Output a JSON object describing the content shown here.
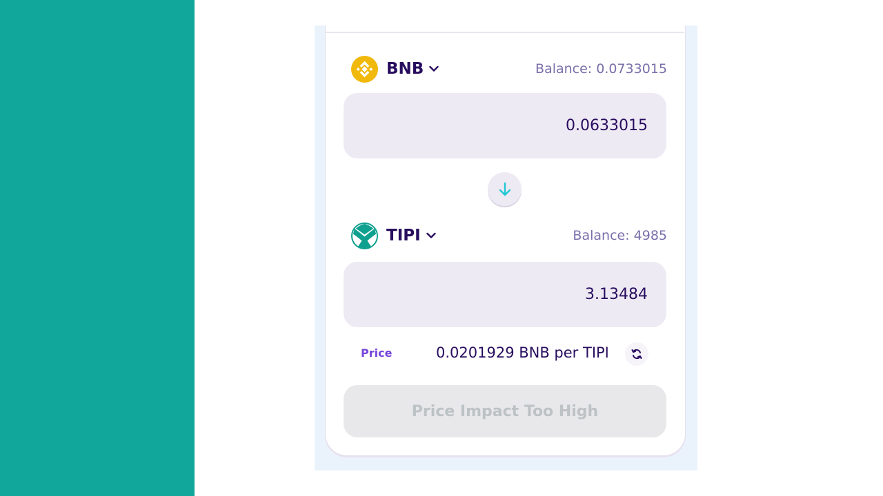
{
  "colors": {
    "sidebar": "#11a79b",
    "text_primary": "#280d5f",
    "text_secondary": "#7a6eaa",
    "accent_purple": "#7645d9",
    "accent_cyan": "#1fc7d4",
    "bnb_yellow": "#f0b90b",
    "tipi_teal": "#0fa08f"
  },
  "from": {
    "token_symbol": "BNB",
    "token_icon": "bnb-logo-icon",
    "balance": "Balance: 0.0733015",
    "amount": "0.0633015"
  },
  "switch": {
    "icon": "arrow-down-icon"
  },
  "to": {
    "token_symbol": "TIPI",
    "token_icon": "tipi-logo-icon",
    "balance": "Balance: 4985",
    "amount": "3.13484"
  },
  "price": {
    "label": "Price",
    "value": "0.0201929 BNB per TIPI",
    "icon": "refresh-icon"
  },
  "action": {
    "label": "Price Impact Too High",
    "disabled": true
  }
}
